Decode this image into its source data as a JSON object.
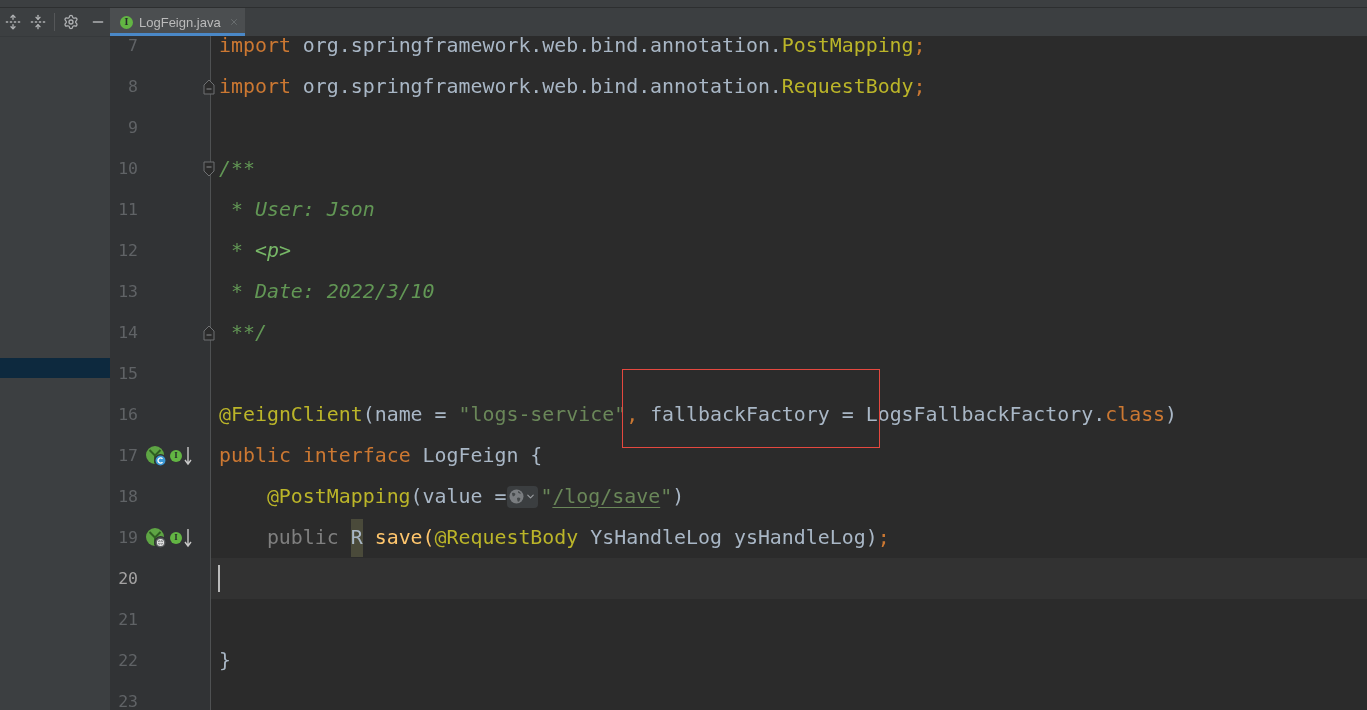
{
  "tool_window": {
    "selection_bar": true
  },
  "tabs": [
    {
      "label": "LogFeign.java",
      "icon_letter": "I",
      "selected": true,
      "closable": true
    }
  ],
  "editor": {
    "lines": [
      {
        "number": "7",
        "current": false,
        "indented": false,
        "tokens": [
          {
            "text": "import",
            "kind": "keyword"
          },
          {
            "text": " org.springframework.web.bind.annotation.",
            "kind": "plain"
          },
          {
            "text": "PostMapping",
            "kind": "annotation"
          },
          {
            "text": ";",
            "kind": "punctuation"
          }
        ]
      },
      {
        "number": "8",
        "current": false,
        "indented": false,
        "fold_marker": {
          "kind": "end"
        },
        "tokens": [
          {
            "text": "import",
            "kind": "keyword"
          },
          {
            "text": " org.springframework.web.bind.annotation.",
            "kind": "plain"
          },
          {
            "text": "RequestBody",
            "kind": "annotation"
          },
          {
            "text": ";",
            "kind": "punctuation"
          }
        ]
      },
      {
        "number": "9",
        "current": false
      },
      {
        "number": "10",
        "current": false,
        "indented": false,
        "fold_marker": {
          "kind": "start"
        },
        "tokens": [
          {
            "text": "/**",
            "kind": "doc"
          }
        ]
      },
      {
        "number": "11",
        "current": false,
        "indented": false,
        "tokens": [
          {
            "text": " * User: Json",
            "kind": "doc"
          }
        ]
      },
      {
        "number": "12",
        "current": false,
        "indented": false,
        "tokens": [
          {
            "text": " * ",
            "kind": "doc"
          },
          {
            "text": "<p>",
            "kind": "doc-tag"
          }
        ]
      },
      {
        "number": "13",
        "current": false,
        "indented": false,
        "tokens": [
          {
            "text": " * Date: 2022/3/10",
            "kind": "doc"
          }
        ]
      },
      {
        "number": "14",
        "current": false,
        "indented": false,
        "fold_marker": {
          "kind": "end"
        },
        "tokens": [
          {
            "text": " **/",
            "kind": "doc"
          }
        ]
      },
      {
        "number": "15",
        "current": false
      },
      {
        "number": "16",
        "current": false,
        "indented": false,
        "tokens": [
          {
            "text": "@FeignClient",
            "kind": "annotation",
            "boxed": false
          },
          {
            "text": "(name = ",
            "kind": "plain",
            "boxed": false
          },
          {
            "text": "\"logs-service\"",
            "kind": "string",
            "boxed": false
          },
          {
            "text": ",",
            "kind": "punctuation",
            "boxed": true
          },
          {
            "text": " fallbackFactory = ",
            "kind": "plain",
            "boxed": true
          },
          {
            "text": "L",
            "kind": "plain",
            "boxed": true
          },
          {
            "text": "ogsFallbackFactory.",
            "kind": "plain",
            "boxed": false
          },
          {
            "text": "class",
            "kind": "keyword",
            "boxed": false
          },
          {
            "text": ")",
            "kind": "plain",
            "boxed": false
          }
        ]
      },
      {
        "number": "17",
        "current": false,
        "indented": false,
        "gutter_icons": [
          {
            "kind": "client"
          },
          {
            "kind": "implemented",
            "letter": "I"
          }
        ],
        "tokens": [
          {
            "text": "public interface",
            "kind": "keyword"
          },
          {
            "text": " LogFeign {",
            "kind": "plain"
          }
        ]
      },
      {
        "number": "18",
        "current": false,
        "indented": true,
        "tokens": [
          {
            "text": "@PostMapping",
            "kind": "annotation"
          },
          {
            "text": "(value =",
            "kind": "plain"
          },
          {
            "kind": "inlay"
          },
          {
            "text": "\"",
            "kind": "string"
          },
          {
            "text": "/log/save",
            "kind": "link"
          },
          {
            "text": "\"",
            "kind": "string"
          },
          {
            "text": ")",
            "kind": "plain"
          }
        ]
      },
      {
        "number": "19",
        "current": false,
        "indented": true,
        "gutter_icons": [
          {
            "kind": "web-endpoint"
          },
          {
            "kind": "implemented",
            "letter": "I"
          }
        ],
        "tokens": [
          {
            "text": "public ",
            "kind": "muted"
          },
          {
            "text": "R",
            "kind": "emphasis"
          },
          {
            "text": " save(",
            "kind": "method"
          },
          {
            "text": "@RequestBody",
            "kind": "annotation"
          },
          {
            "text": " YsHandleLog ysHandleLog)",
            "kind": "plain"
          },
          {
            "text": ";",
            "kind": "punctuation"
          }
        ]
      },
      {
        "number": "20",
        "current": true
      },
      {
        "number": "21",
        "current": false
      },
      {
        "number": "22",
        "current": false,
        "indented": false,
        "tokens": [
          {
            "text": "}",
            "kind": "plain"
          }
        ]
      },
      {
        "number": "23",
        "current": false
      }
    ]
  }
}
